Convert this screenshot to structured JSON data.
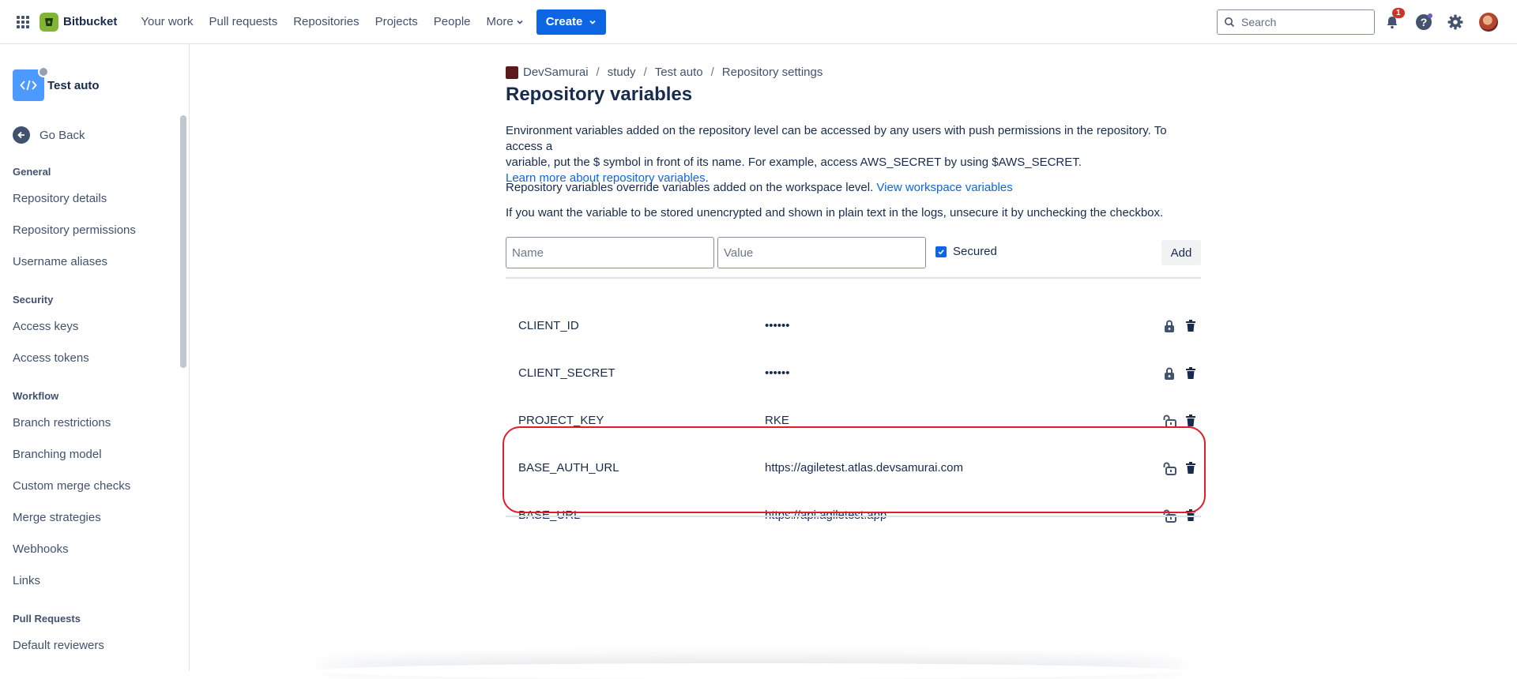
{
  "topnav": {
    "brand": "Bitbucket",
    "items": [
      "Your work",
      "Pull requests",
      "Repositories",
      "Projects",
      "People",
      "More"
    ],
    "create_label": "Create",
    "search_placeholder": "Search",
    "notification_count": "1"
  },
  "sidebar": {
    "repo_name": "Test auto",
    "go_back": "Go Back",
    "sections": [
      {
        "title": "General",
        "items": [
          "Repository details",
          "Repository permissions",
          "Username aliases"
        ]
      },
      {
        "title": "Security",
        "items": [
          "Access keys",
          "Access tokens"
        ]
      },
      {
        "title": "Workflow",
        "items": [
          "Branch restrictions",
          "Branching model",
          "Custom merge checks",
          "Merge strategies",
          "Webhooks",
          "Links"
        ]
      },
      {
        "title": "Pull Requests",
        "items": [
          "Default reviewers"
        ]
      }
    ]
  },
  "breadcrumb": [
    "DevSamurai",
    "study",
    "Test auto",
    "Repository settings"
  ],
  "page_title": "Repository variables",
  "description": {
    "line1": "Environment variables added on the repository level can be accessed by any users with push permissions in the repository. To access a",
    "line2": "variable, put the $ symbol in front of its name. For example, access AWS_SECRET by using $AWS_SECRET.",
    "learn_more": "Learn more about repository variables",
    "period": ".",
    "override_text": "Repository variables override variables added on the workspace level.",
    "workspace_link": "View workspace variables",
    "unsecure_text": "If you want the variable to be stored unencrypted and shown in plain text in the logs, unsecure it by unchecking the checkbox."
  },
  "form": {
    "name_placeholder": "Name",
    "value_placeholder": "Value",
    "secured_label": "Secured",
    "secured_checked": true,
    "add_label": "Add"
  },
  "variables": [
    {
      "name": "CLIENT_ID",
      "value": "••••••",
      "secured": true
    },
    {
      "name": "CLIENT_SECRET",
      "value": "••••••",
      "secured": true
    },
    {
      "name": "PROJECT_KEY",
      "value": "RKE",
      "secured": false
    },
    {
      "name": "BASE_AUTH_URL",
      "value": "https://agiletest.atlas.devsamurai.com",
      "secured": false
    },
    {
      "name": "BASE_URL",
      "value": "https://api.agiletest.app",
      "secured": false
    }
  ],
  "colors": {
    "primary": "#0c66e4",
    "brand_green": "#82b536",
    "highlight": "#e01e27"
  }
}
